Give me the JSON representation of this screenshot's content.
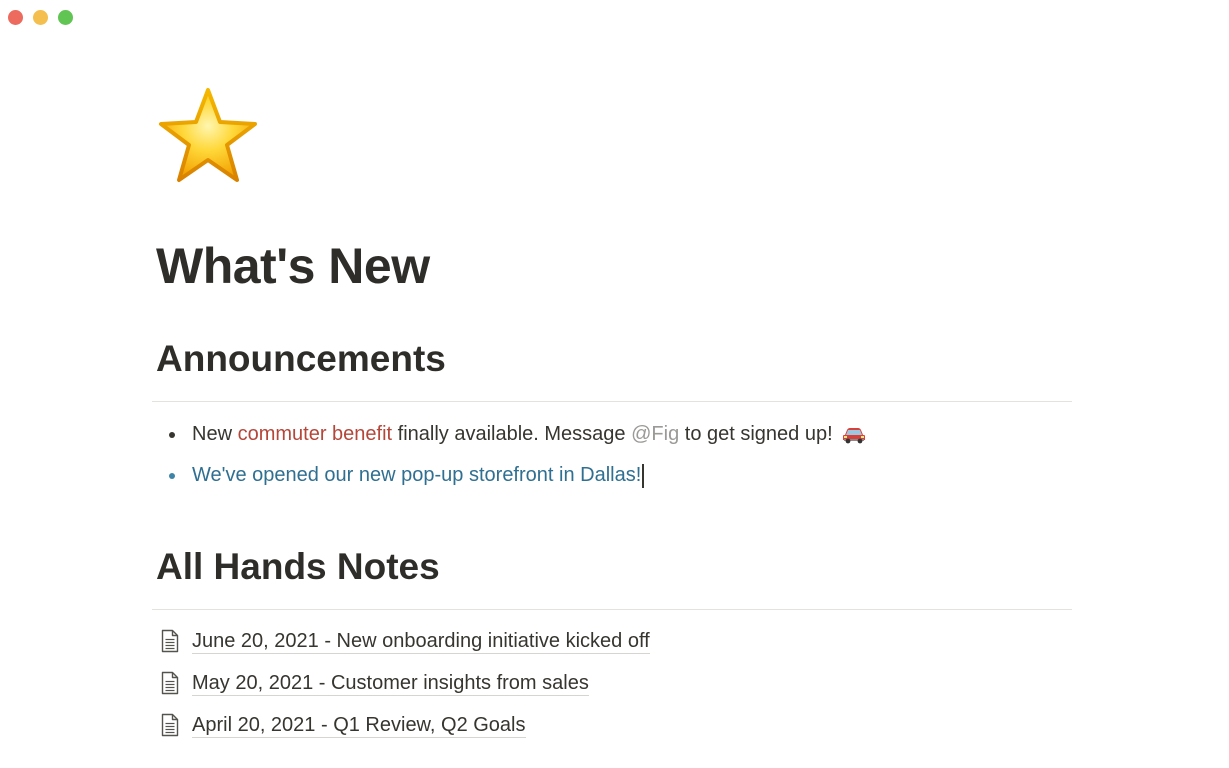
{
  "window": {
    "traffic_lights": [
      {
        "name": "close",
        "color": "#ec6a5e"
      },
      {
        "name": "minimize",
        "color": "#f4bf4f"
      },
      {
        "name": "zoom",
        "color": "#61c554"
      }
    ]
  },
  "page": {
    "icon": "star-emoji",
    "title": "What's New"
  },
  "announcements": {
    "heading": "Announcements",
    "items": [
      {
        "prefix": "New ",
        "highlight": "commuter benefit",
        "middle": " finally available. Message ",
        "mention": "@Fig",
        "suffix": " to get signed up!",
        "emoji": "car-emoji"
      },
      {
        "text": "We've opened our new pop-up storefront in Dallas!"
      }
    ]
  },
  "all_hands": {
    "heading": "All Hands Notes",
    "pages": [
      {
        "label": "June 20, 2021 - New onboarding initiative kicked off",
        "icon": "document-icon"
      },
      {
        "label": "May 20, 2021 - Customer insights from sales",
        "icon": "document-icon"
      },
      {
        "label": "April 20, 2021 - Q1 Review, Q2 Goals",
        "icon": "document-icon"
      }
    ]
  }
}
